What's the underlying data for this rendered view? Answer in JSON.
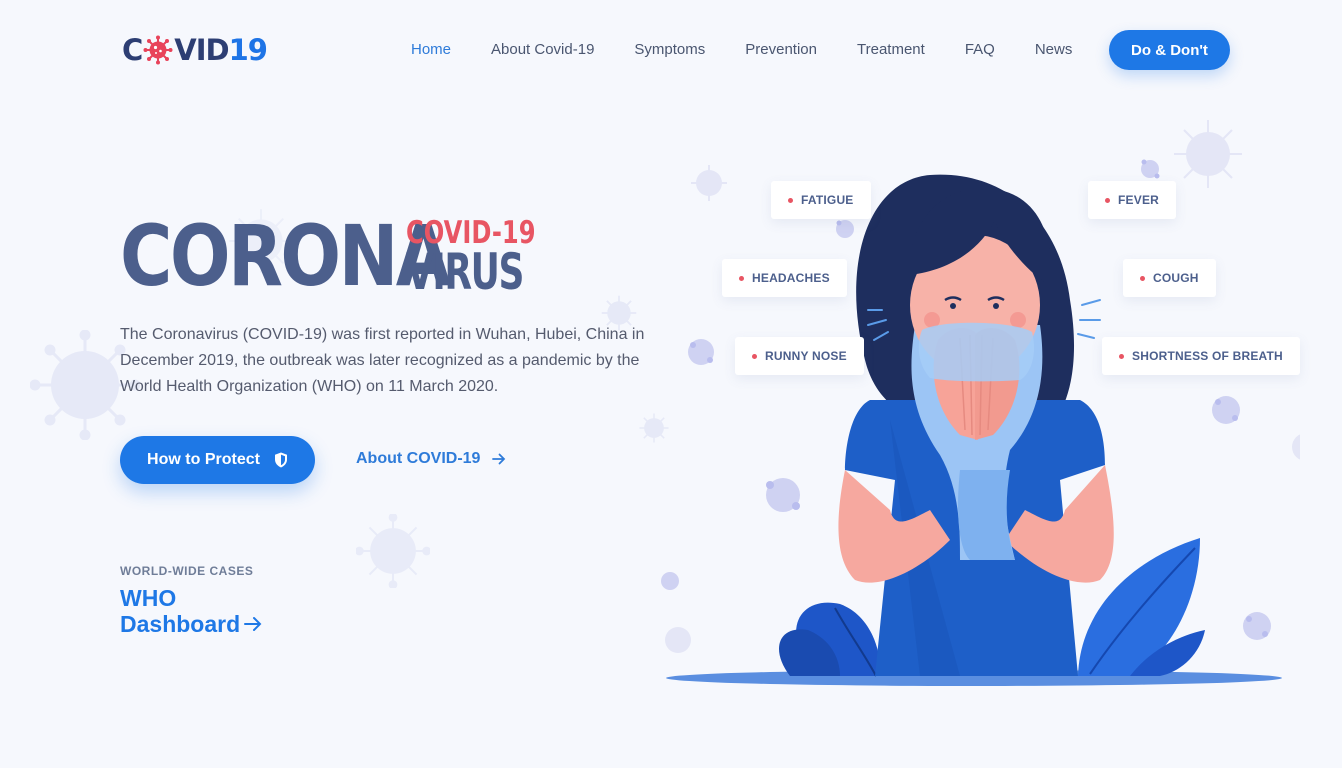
{
  "brand": {
    "part1": "C",
    "part2": "VID",
    "part3": "19"
  },
  "nav": {
    "items": [
      {
        "label": "Home",
        "active": true
      },
      {
        "label": "About Covid-19",
        "active": false
      },
      {
        "label": "Symptoms",
        "active": false
      },
      {
        "label": "Prevention",
        "active": false
      },
      {
        "label": "Treatment",
        "active": false
      },
      {
        "label": "FAQ",
        "active": false
      },
      {
        "label": "News",
        "active": false
      }
    ],
    "cta": "Do & Don't"
  },
  "hero": {
    "title_big": "CORONA",
    "title_small_top": "COVID-19",
    "title_small_bottom": "VIRUS",
    "description": "The Coronavirus (COVID-19) was first reported in Wuhan, Hubei, China in December 2019, the outbreak was later recognized as a pandemic by the World Health Organization (WHO) on 11 March 2020.",
    "primary_button": "How to Protect",
    "secondary_link": "About COVID-19"
  },
  "cases": {
    "label": "WORLD-WIDE CASES",
    "link_line1": "WHO",
    "link_line2": "Dashboard"
  },
  "symptoms": [
    "FATIGUE",
    "HEADACHES",
    "RUNNY NOSE",
    "FEVER",
    "COUGH",
    "SHORTNESS OF BREATH"
  ],
  "colors": {
    "accent": "#1e78e6",
    "title": "#4c5f8c",
    "highlight": "#e85563",
    "background": "#f6f8fd"
  }
}
